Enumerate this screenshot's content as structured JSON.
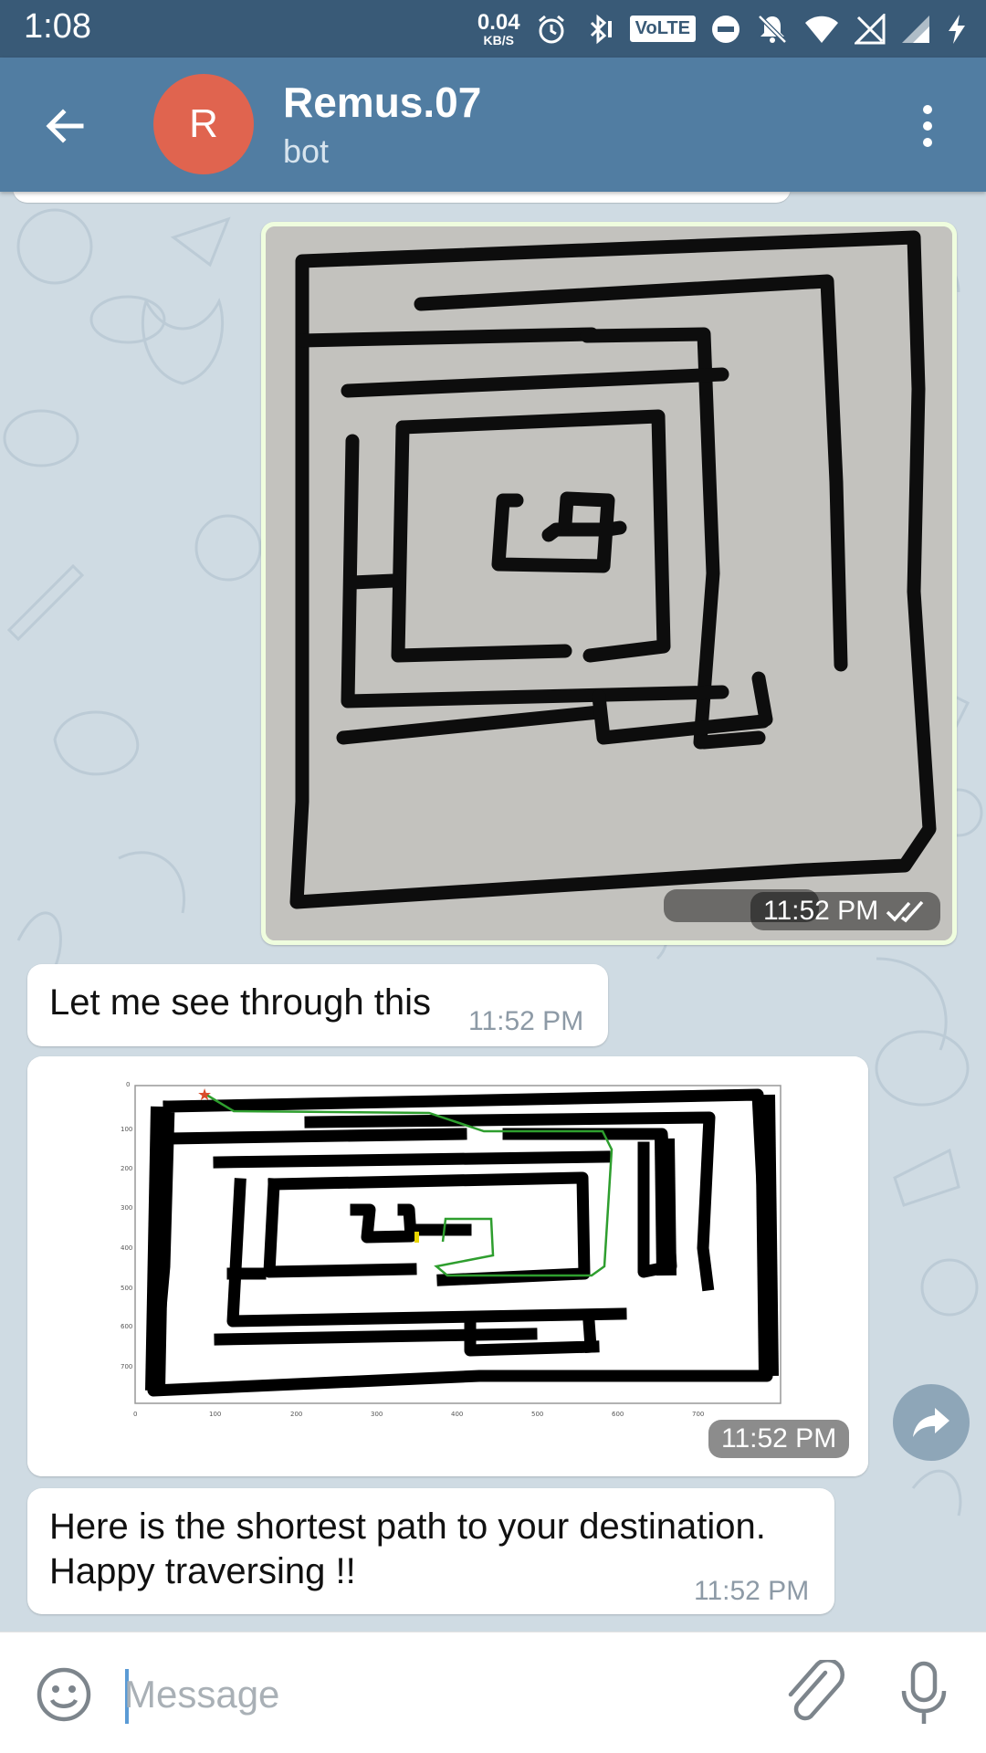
{
  "status_bar": {
    "time": "1:08",
    "net_speed_value": "0.04",
    "net_speed_unit": "KB/S",
    "volte_label": "VoLTE",
    "icons": [
      "alarm-icon",
      "bluetooth-icon",
      "volte-icon",
      "do-not-disturb-icon",
      "notifications-off-icon",
      "wifi-icon",
      "sim-off-icon",
      "signal-icon",
      "charging-icon"
    ]
  },
  "header": {
    "avatar_letter": "R",
    "avatar_color": "#e0644f",
    "title": "Remus.07",
    "subtitle": "bot",
    "bar_color": "#517da2"
  },
  "messages": [
    {
      "type": "photo",
      "direction": "outgoing",
      "time": "11:52 PM",
      "status": "read"
    },
    {
      "type": "text",
      "direction": "incoming",
      "text": "Let me see through this",
      "time": "11:52 PM"
    },
    {
      "type": "photo",
      "direction": "incoming",
      "time": "11:52 PM",
      "plot": {
        "x_ticks": [
          "0",
          "100",
          "200",
          "300",
          "400",
          "500",
          "600",
          "700"
        ],
        "y_ticks": [
          "0",
          "100",
          "200",
          "300",
          "400",
          "500",
          "600",
          "700"
        ]
      }
    },
    {
      "type": "text",
      "direction": "incoming",
      "line1": "Here is the shortest path to your destination.",
      "line2": "Happy traversing !!",
      "time": "11:52 PM"
    }
  ],
  "composer": {
    "placeholder": "Message"
  }
}
